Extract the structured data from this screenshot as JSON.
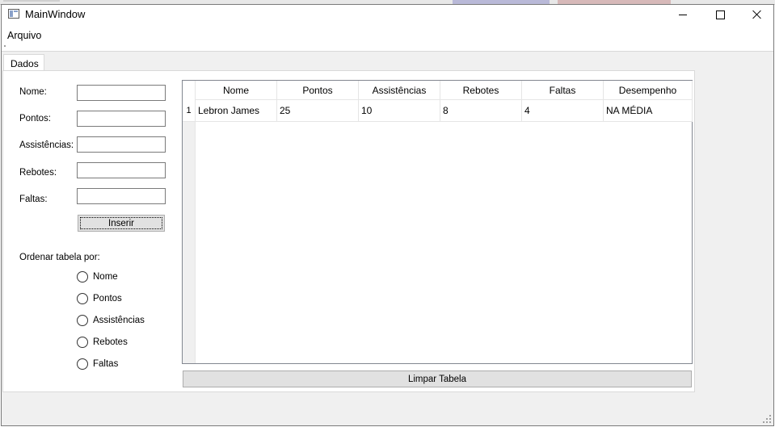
{
  "window": {
    "title": "MainWindow"
  },
  "menu": {
    "items": [
      "Arquivo"
    ]
  },
  "tabs": [
    "Dados"
  ],
  "form": {
    "fields": [
      {
        "label": "Nome:",
        "value": ""
      },
      {
        "label": "Pontos:",
        "value": ""
      },
      {
        "label": "Assistências:",
        "value": ""
      },
      {
        "label": "Rebotes:",
        "value": ""
      },
      {
        "label": "Faltas:",
        "value": ""
      }
    ],
    "insert_button": "Inserir",
    "sort_label": "Ordenar tabela por:",
    "sort_options": [
      "Nome",
      "Pontos",
      "Assistências",
      "Rebotes",
      "Faltas"
    ]
  },
  "table": {
    "columns": [
      "Nome",
      "Pontos",
      "Assistências",
      "Rebotes",
      "Faltas",
      "Desempenho"
    ],
    "rows": [
      {
        "index": "1",
        "cells": [
          "Lebron James",
          "25",
          "10",
          "8",
          "4",
          "NA MÉDIA"
        ]
      }
    ]
  },
  "clear_button": "Limpar Tabela"
}
